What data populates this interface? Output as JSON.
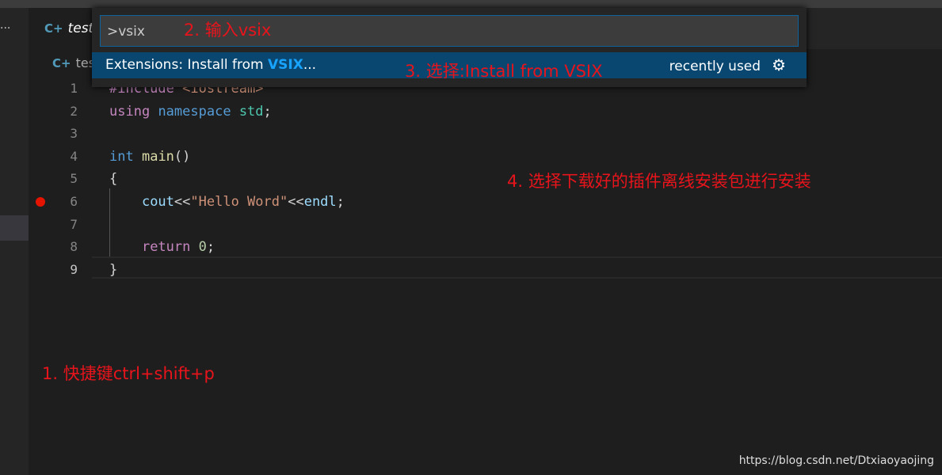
{
  "sidebar": {
    "more_icon": "···"
  },
  "tab": {
    "label": "test.",
    "icon": "C++-file-icon",
    "icon_text": "C+"
  },
  "breadcrumb": {
    "label": "tes"
  },
  "editor": {
    "lines": [
      {
        "n": "1",
        "html": "<span class='kw'>#include</span> <span class='str'>&lt;iostream&gt;</span>"
      },
      {
        "n": "2",
        "html": "<span class='kw'>using</span> <span class='kb'>namespace</span> <span class='ns'>std</span>;"
      },
      {
        "n": "3",
        "html": ""
      },
      {
        "n": "4",
        "html": "<span class='kb'>int</span> <span class='fn'>main</span>()"
      },
      {
        "n": "5",
        "html": "{"
      },
      {
        "n": "6",
        "html": "    <span class='var'>cout</span>&lt;&lt;<span class='str'>\"Hello Word\"</span>&lt;&lt;<span class='var'>endl</span>;"
      },
      {
        "n": "7",
        "html": ""
      },
      {
        "n": "8",
        "html": "    <span class='kw'>return</span> <span class='num'>0</span>;"
      },
      {
        "n": "9",
        "html": "}"
      }
    ],
    "breakpoint_line": "6",
    "current_line": "9"
  },
  "quick_pick": {
    "input_value": ">vsix",
    "item_prefix": "Extensions: Install from ",
    "item_highlight": "VSIX",
    "item_suffix": "...",
    "item_detail": "recently used",
    "gear_icon": "⚙"
  },
  "annotations": {
    "step1": "1. 快捷键ctrl+shift+p",
    "step2": "2. 输入vsix",
    "step3": "3. 选择:Install from VSIX",
    "step4": "4. 选择下载好的插件离线安装包进行安装"
  },
  "watermark": "https://blog.csdn.net/Dtxiaoyaojing",
  "colors": {
    "accent": "#094771",
    "annotation": "#e8141c",
    "breakpoint": "#e51400"
  }
}
